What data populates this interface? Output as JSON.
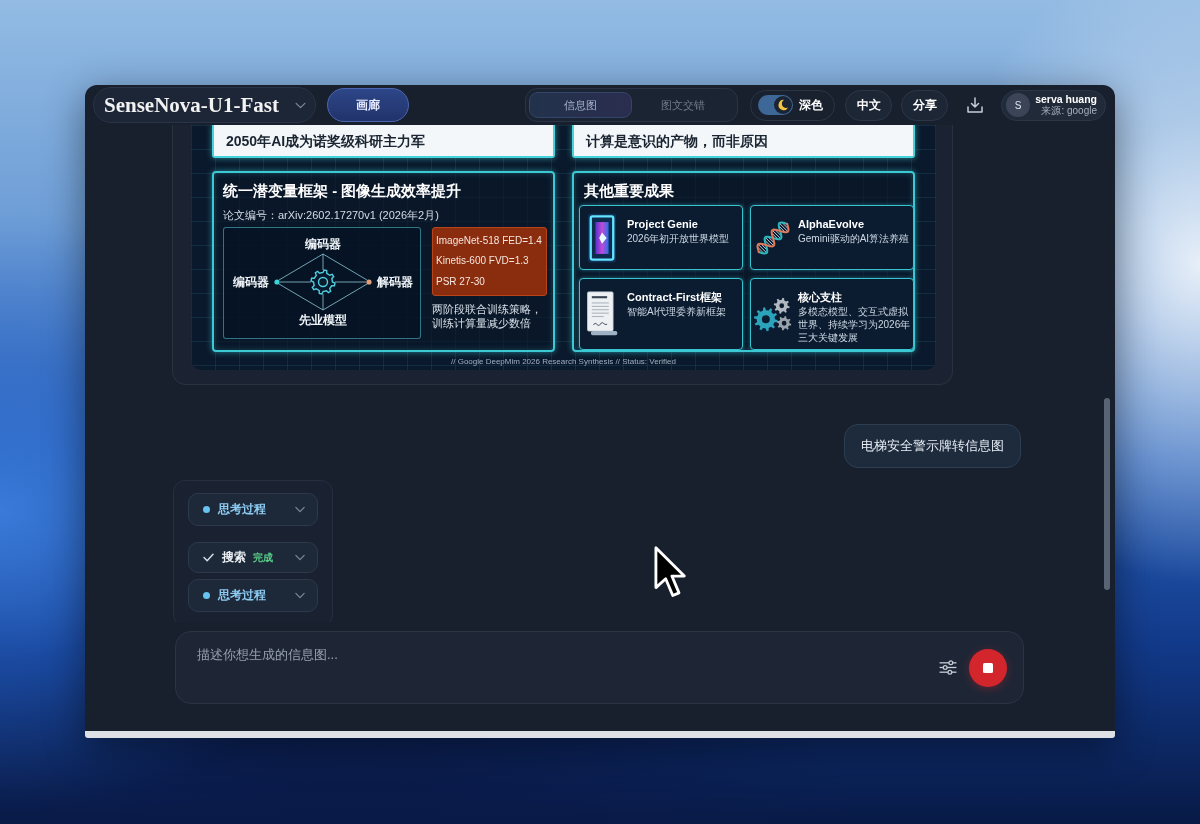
{
  "header": {
    "model_selector": "SenseNova-U1-Fast",
    "gallery_button": "画廊",
    "mode_tabs": [
      {
        "label": "信息图",
        "selected": true
      },
      {
        "label": "图文交错",
        "selected": false
      }
    ],
    "theme_toggle": {
      "label": "深色",
      "on": true
    },
    "language_button": "中文",
    "share_button": "分享",
    "user": {
      "avatar": "S",
      "name": "serva huang",
      "source": "来源: google"
    }
  },
  "infographic": {
    "headlines": [
      "2050年AI成为诺奖级科研主力军",
      "计算是意识的产物，而非原因"
    ],
    "framework_panel": {
      "title": "统一潜变量框架 - 图像生成效率提升",
      "paper_id": "论文编号：arXiv:2602.17270v1 (2026年2月)",
      "diagram": {
        "top": "编码器",
        "left": "编码器",
        "right": "解码器",
        "bottom": "先业模型"
      },
      "metrics": [
        "ImageNet-518 FED=1.4",
        "Kinetis-600 FVD=1.3",
        "PSR 27-30"
      ],
      "note": "两阶段联合训练策略，训练计算量减少数倍"
    },
    "results_panel": {
      "title": "其他重要成果",
      "cards": [
        {
          "kind": "portal",
          "title": "Project Genie",
          "text": "2026年初开放世界模型"
        },
        {
          "kind": "dna",
          "title": "AlphaEvolve",
          "text": "Gemini驱动的AI算法养殖"
        },
        {
          "kind": "document",
          "title": "Contract-First框架",
          "text": "智能AI代理委养新框架"
        },
        {
          "kind": "gears",
          "title": "核心支柱",
          "text": "多模态模型、交互式虚拟世界、持续学习为2026年三大关键发展"
        }
      ]
    },
    "footer": "// Google DeepMim 2026 Research Synthesis // Status: Verified"
  },
  "messages": [
    {
      "kind": "user",
      "text": "电梯安全警示牌转信息图"
    },
    {
      "kind": "assistant",
      "steps": [
        {
          "kind": "thinking",
          "label": "思考过程"
        },
        {
          "kind": "search",
          "label": "搜索",
          "status": "完成"
        },
        {
          "kind": "thinking",
          "label": "思考过程"
        }
      ]
    }
  ],
  "composer": {
    "placeholder": "描述你想生成的信息图...",
    "generating": true
  }
}
